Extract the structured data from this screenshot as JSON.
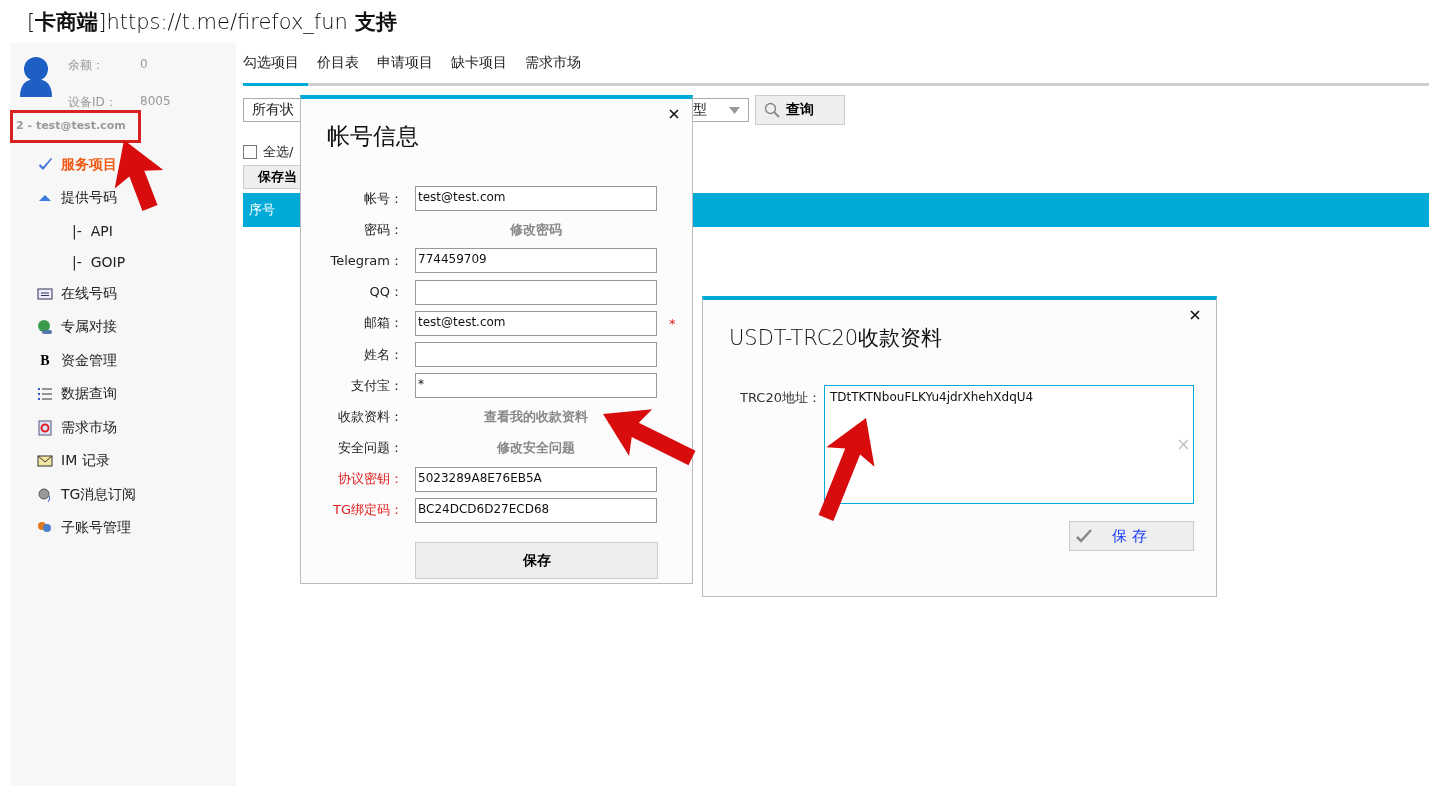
{
  "title": "[**卡商端**]https://t.me/firefox_fun **支持**",
  "sidebar": {
    "balance_label": "余额：",
    "balance": "0",
    "device_label": "设备ID：",
    "device_id": "8005",
    "account": "2 - test@test.com",
    "items": [
      {
        "label": "服务项目",
        "selected": true
      },
      {
        "label": "提供号码",
        "selected": false,
        "children": [
          {
            "label": "|-  API",
            "selected": false
          },
          {
            "label": "|-  GOIP",
            "selected": false
          }
        ]
      },
      {
        "label": "在线号码",
        "selected": false
      },
      {
        "label": "专属对接",
        "selected": false
      },
      {
        "label": "资金管理",
        "selected": false,
        "glyph": "B"
      },
      {
        "label": "数据查询",
        "selected": false
      },
      {
        "label": "需求市场",
        "selected": false
      },
      {
        "label": "IM 记录",
        "selected": false
      },
      {
        "label": "TG消息订阅",
        "selected": false
      },
      {
        "label": "子账号管理",
        "selected": false
      }
    ]
  },
  "tabs": [
    {
      "label": "勾选项目",
      "selected": true
    },
    {
      "label": "价目表",
      "selected": false
    },
    {
      "label": "申请项目",
      "selected": false
    },
    {
      "label": "缺卡项目",
      "selected": false
    },
    {
      "label": "需求市场",
      "selected": false
    }
  ],
  "filters": [
    {
      "value": "所有状"
    },
    {
      "value": "型"
    }
  ],
  "search_button": "查询",
  "select_all": {
    "label": "全选/",
    "checked": false
  },
  "save_button": "保存当",
  "table": {
    "columns": [
      "序号"
    ]
  },
  "account_dialog": {
    "title": "帐号信息",
    "fields": [
      {
        "label": "帐号：",
        "kind": "input",
        "value": "test@test.com",
        "emphasized": false
      },
      {
        "label": "密码：",
        "kind": "link",
        "value": "修改密码",
        "emphasized": false
      },
      {
        "label": "Telegram：",
        "kind": "input",
        "value": "774459709",
        "emphasized": false
      },
      {
        "label": "QQ：",
        "kind": "input",
        "emphasized": false
      },
      {
        "label": "邮箱：",
        "kind": "input",
        "value": "test@test.com",
        "emphasized": false,
        "note": "*"
      },
      {
        "label": "姓名：",
        "kind": "input",
        "emphasized": false
      },
      {
        "label": "支付宝：",
        "kind": "input",
        "value": "*",
        "emphasized": false
      },
      {
        "label": "收款资料：",
        "kind": "link",
        "value": "查看我的收款资料",
        "emphasized": false
      },
      {
        "label": "安全问题：",
        "kind": "link",
        "value": "修改安全问题",
        "emphasized": false
      },
      {
        "label": "协议密钥：",
        "kind": "input",
        "value": "5023289A8E76EB5A",
        "emphasized": true
      },
      {
        "label": "TG绑定码：",
        "kind": "input",
        "value": "BC24DCD6D27ECD68",
        "emphasized": true
      }
    ],
    "save_button": "保存"
  },
  "payment_dialog": {
    "title": "USDT-TRC20收款资料",
    "address_label": "TRC20地址：",
    "address": "TDtTKTNbouFLKYu4jdrXhehXdqU4",
    "save_button": "保 存"
  }
}
